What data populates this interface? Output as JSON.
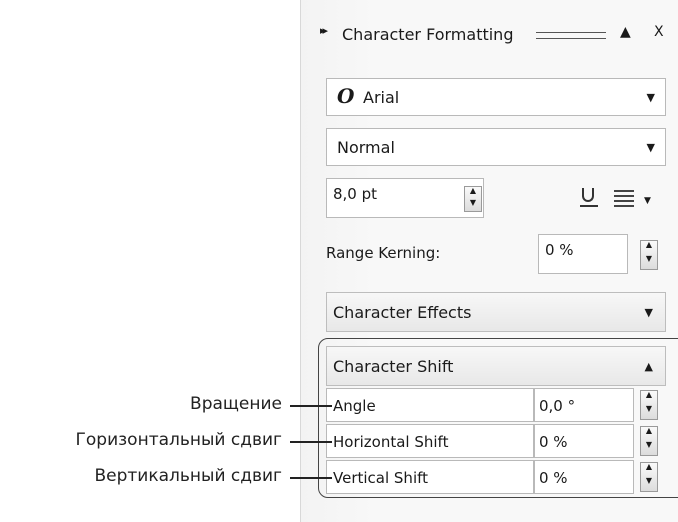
{
  "panel": {
    "title": "Character Formatting",
    "title_arrow": "▸▸",
    "collapse_icon": "▲",
    "close_icon": "X",
    "font_icon": "O",
    "font_name": "Arial",
    "font_style": "Normal",
    "font_size": "8,0 pt",
    "range_kerning_label": "Range Kerning:",
    "range_kerning_value": "0 %",
    "character_effects": "Character Effects",
    "character_shift": "Character Shift",
    "rows": [
      {
        "label": "Angle",
        "value": "0,0 °"
      },
      {
        "label": "Horizontal Shift",
        "value": "0 %"
      },
      {
        "label": "Vertical Shift",
        "value": "0 %"
      }
    ]
  },
  "annotations": [
    "Вращение",
    "Горизонтальный сдвиг",
    "Вертикальный сдвиг"
  ]
}
